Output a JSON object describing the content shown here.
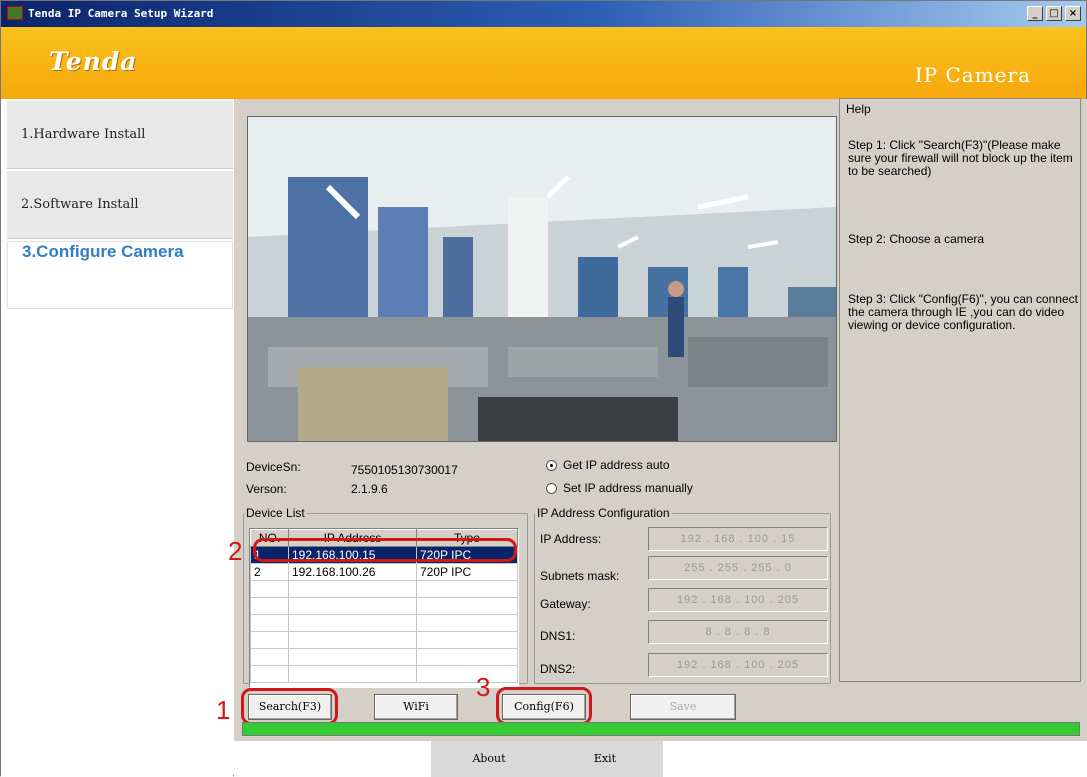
{
  "window": {
    "title": "Tenda IP Camera Setup Wizard",
    "min": "_",
    "max": "□",
    "close": "×"
  },
  "banner": {
    "logo": "Tenda",
    "product": "IP Camera"
  },
  "nav": [
    {
      "label": "1.Hardware Install"
    },
    {
      "label": "2.Software Install"
    },
    {
      "label": "3.Configure Camera"
    }
  ],
  "device": {
    "sn_label": "DeviceSn:",
    "sn_value": "7550105130730017",
    "version_label": "Verson:",
    "version_value": "2.1.9.6"
  },
  "ip_mode": {
    "auto": "Get IP address auto",
    "manual": "Set IP address manually",
    "selected": "auto"
  },
  "device_list": {
    "legend": "Device List",
    "columns": [
      "NO.",
      "IP Address",
      "Type"
    ],
    "rows": [
      [
        "1",
        "192.168.100.15",
        "720P IPC"
      ],
      [
        "2",
        "192.168.100.26",
        "720P IPC"
      ]
    ]
  },
  "ip_config": {
    "legend": "IP Address Configuration",
    "fields": [
      {
        "label": "IP Address:",
        "value": "192 . 168 . 100 . 15"
      },
      {
        "label": "Subnets mask:",
        "value": "255 . 255 . 255 . 0"
      },
      {
        "label": "Gateway:",
        "value": "192 . 168 . 100 . 205"
      },
      {
        "label": "DNS1:",
        "value": "8 . 8 . 8 . 8"
      },
      {
        "label": "DNS2:",
        "value": "192 . 168 . 100 . 205"
      }
    ]
  },
  "buttons": {
    "search": "Search(F3)",
    "wifi": "WiFi",
    "config": "Config(F6)",
    "save": "Save"
  },
  "annotations": {
    "n1": "1",
    "n2": "2",
    "n3": "3"
  },
  "help": {
    "title": "Help",
    "step1": "Step 1: Click \"Search(F3)\"(Please make sure your firewall will not block up the item to be searched)",
    "step2": "Step 2: Choose a camera",
    "step3": "Step 3: Click \"Config(F6)\", you can connect the camera through IE ,you can do video viewing or device configuration."
  },
  "footer": {
    "about": "About",
    "exit": "Exit"
  },
  "colors": {
    "banner": "#f6a70c",
    "accent": "#2f7fc4",
    "progress": "#33cc33",
    "annotation": "#d01818"
  }
}
